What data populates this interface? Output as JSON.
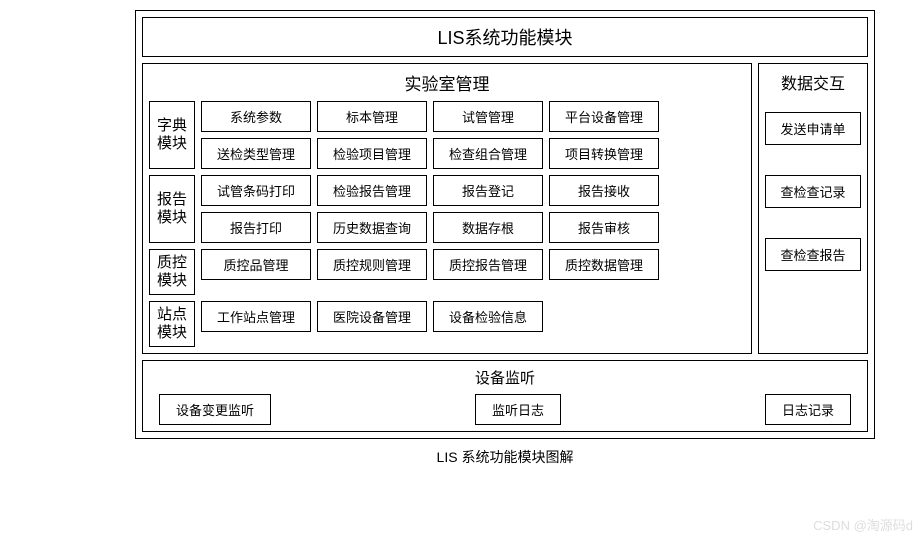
{
  "title": "LIS系统功能模块",
  "lab": {
    "title": "实验室管理",
    "modules": [
      {
        "label": "字典模块",
        "rows": [
          [
            "系统参数",
            "标本管理",
            "试管管理",
            "平台设备管理"
          ],
          [
            "送检类型管理",
            "检验项目管理",
            "检查组合管理",
            "项目转换管理"
          ]
        ]
      },
      {
        "label": "报告模块",
        "rows": [
          [
            "试管条码打印",
            "检验报告管理",
            "报告登记",
            "报告接收"
          ],
          [
            "报告打印",
            "历史数据查询",
            "数据存根",
            "报告审核"
          ]
        ]
      },
      {
        "label": "质控模块",
        "rows": [
          [
            "质控品管理",
            "质控规则管理",
            "质控报告管理",
            "质控数据管理"
          ]
        ]
      },
      {
        "label": "站点模块",
        "rows": [
          [
            "工作站点管理",
            "医院设备管理",
            "设备检验信息"
          ]
        ]
      }
    ]
  },
  "side": {
    "title": "数据交互",
    "items": [
      "发送申请单",
      "查检查记录",
      "查检查报告"
    ]
  },
  "bottom": {
    "title": "设备监听",
    "items": [
      "设备变更监听",
      "监听日志",
      "日志记录"
    ]
  },
  "caption": "LIS 系统功能模块图解",
  "watermark": "CSDN @淘源码d"
}
